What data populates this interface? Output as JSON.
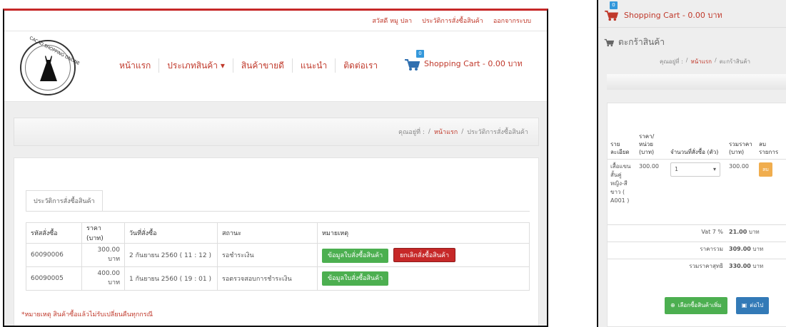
{
  "topbar": {
    "greeting": "สวัสดี หมู ปลา",
    "history_link": "ประวัติการสั่งซื้อสินค้า",
    "logout_link": "ออกจากระบบ"
  },
  "logo": {
    "text": "CACAO SHOPPING ONLINE"
  },
  "nav": {
    "items": [
      "หน้าแรก",
      "ประเภทสินค้า ▾",
      "สินค้าขายดี",
      "แนะนำ",
      "ติดต่อเรา"
    ]
  },
  "cart": {
    "badge": "0",
    "label": "Shopping Cart - 0.00 บาท"
  },
  "breadcrumb": {
    "prefix": "คุณอยู่ที่ :",
    "home": "หน้าแรก",
    "sep": "/",
    "current": "ประวัติการสั่งซื้อสินค้า"
  },
  "tab": {
    "label": "ประวัติการสั่งซื้อสินค้า"
  },
  "orders_table": {
    "headers": [
      "รหัสสั่งซื้อ",
      "ราคา (บาท)",
      "วันที่สั่งซื้อ",
      "สถานะ",
      "หมายเหตุ"
    ],
    "rows": [
      {
        "id": "60090006",
        "price": "300.00 บาท",
        "date": "2 กันยายน 2560 ( 11 : 12 )",
        "status": "รอชำระเงิน",
        "detail_btn": "ข้อมูลใบสั่งซื้อสินค้า",
        "cancel_btn": "ยกเลิกสั่งซื้อสินค้า"
      },
      {
        "id": "60090005",
        "price": "400.00 บาท",
        "date": "1 กันยายน 2560 ( 19 : 01 )",
        "status": "รอตรวจสอบการชำระเงิน",
        "detail_btn": "ข้อมูลใบสั่งซื้อสินค้า"
      }
    ]
  },
  "note": "*หมายเหตุ สินค้าซื้อแล้วไม่รับเปลี่ยนคืนทุกกรณี",
  "right": {
    "cart_badge": "0",
    "cart_label": "Shopping Cart - 0.00 บาท",
    "title": "ตะกร้าสินค้า",
    "breadcrumb": {
      "prefix": "คุณอยู่ที่ :",
      "sep": "/",
      "home": "หน้าแรก",
      "current": "ตะกร้าสินค้า"
    },
    "headers": [
      "รายละเอียด",
      "ราคา/หน่วย (บาท)",
      "จำนวนที่สั่งซื้อ (ตัว)",
      "รวมราคา (บาท)",
      "ลบรายการ"
    ],
    "item": {
      "name": "เสื้อแขนสั้นคู่หญิง-สีขาว ( A001 )",
      "price": "300.00",
      "qty": "1",
      "total": "300.00",
      "delete_btn": "ลบ"
    },
    "vat_label": "Vat 7 %",
    "vat_value": "21.00",
    "subtotal_label": "ราคารวม",
    "subtotal_value": "309.00",
    "grand_label": "รวมราคาสุทธิ",
    "grand_value": "330.00",
    "currency": "บาท",
    "continue_btn": "เลือกซื้อสินค้าเพิ่ม",
    "next_btn": "ต่อไป"
  }
}
